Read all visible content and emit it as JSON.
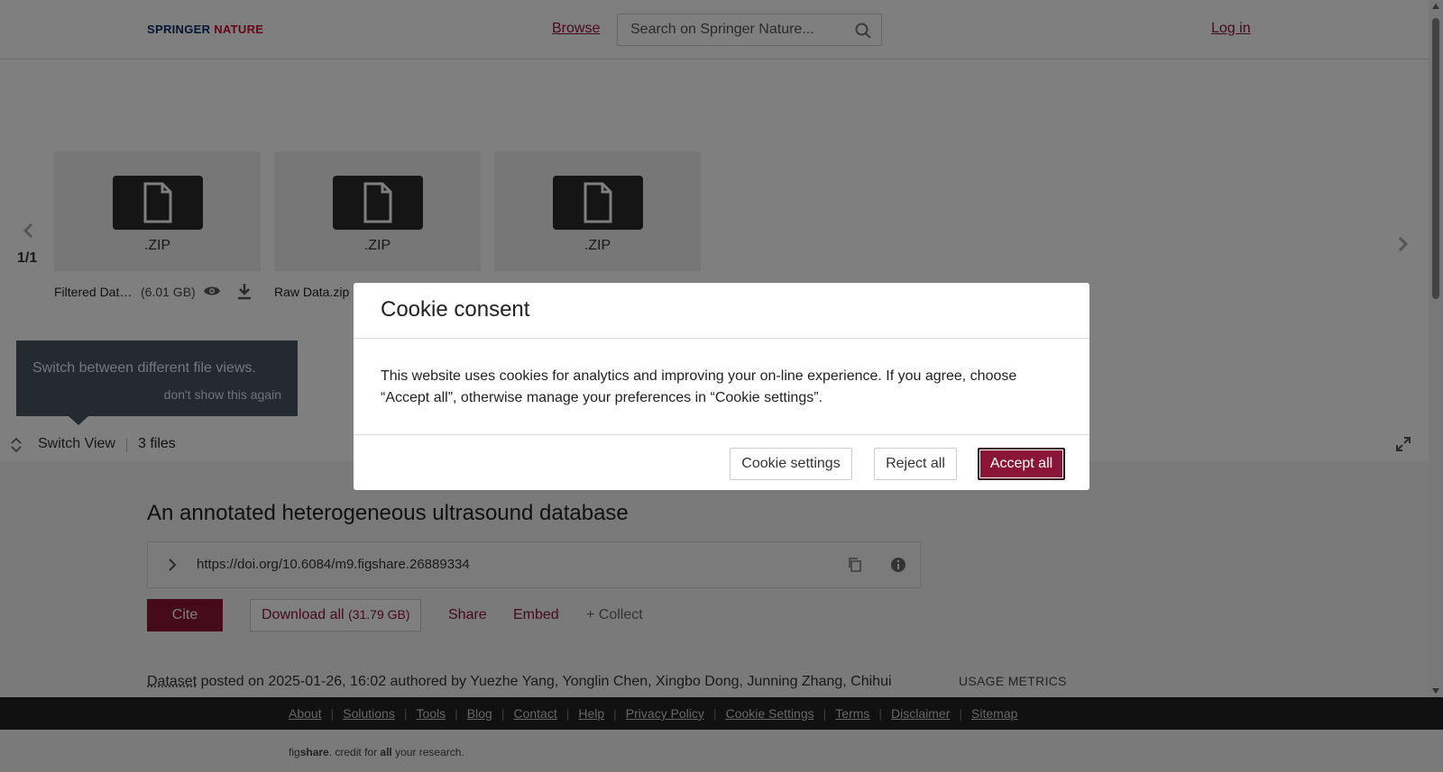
{
  "header": {
    "logo_part1": "SPRINGER",
    "logo_part2": "NATURE",
    "browse_label": "Browse",
    "search_placeholder": "Search on Springer Nature...",
    "login_label": "Log in"
  },
  "files": {
    "page_indicator": "1/1",
    "tiles": [
      {
        "ext": ".ZIP",
        "name": "Filtered Dat…",
        "size": "(6.01 GB)"
      },
      {
        "ext": ".ZIP",
        "name": "Raw Data.zip"
      },
      {
        "ext": ".ZIP"
      }
    ],
    "tooltip_message": "Switch between different file views.",
    "tooltip_dismiss": "don't show this again",
    "switch_view_label": "Switch View",
    "file_count": "3 files"
  },
  "item": {
    "title": "An annotated heterogeneous ultrasound database",
    "doi": "https://doi.org/10.6084/m9.figshare.26889334",
    "cite_label": "Cite",
    "download_label": "Download all",
    "download_size": "(31.79 GB)",
    "share_label": "Share",
    "embed_label": "Embed",
    "collect_label": "+ Collect",
    "type_label": "Dataset",
    "meta_text": " posted on 2025-01-26, 16:02 authored by Yuezhe Yang, Yonglin Chen, Xingbo Dong, Junning Zhang, Chihui",
    "usage_metrics_label": "USAGE METRICS"
  },
  "footer": {
    "links": [
      "About",
      "Solutions",
      "Tools",
      "Blog",
      "Contact",
      "Help",
      "Privacy Policy",
      "Cookie Settings",
      "Terms",
      "Disclaimer",
      "Sitemap"
    ],
    "fig_prefix": "fig",
    "fig_bold": "share",
    "fig_mid": ". credit for ",
    "fig_all": "all",
    "fig_suffix": " your research."
  },
  "cookie_modal": {
    "title": "Cookie consent",
    "body": "This website uses cookies for analytics and improving your on-line experience. If you agree, choose “Accept all”, otherwise manage your preferences in “Cookie settings”.",
    "settings_label": "Cookie settings",
    "reject_label": "Reject all",
    "accept_label": "Accept all"
  },
  "colors": {
    "brand": "#8a1538",
    "footer_bg": "#222222"
  }
}
